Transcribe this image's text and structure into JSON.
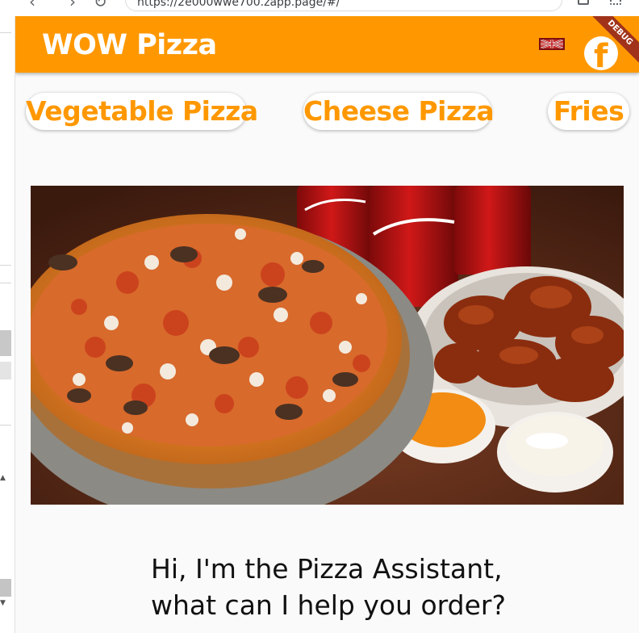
{
  "browser": {
    "url": "https://2e000wwe700.zapp.page/#/",
    "back_glyph": "‹",
    "forward_glyph": "›",
    "reload_glyph": "↻"
  },
  "appbar": {
    "title": "WOW Pizza",
    "debug_banner": "DEBUG",
    "facebook_glyph": "f",
    "accent_color": "#ff9800"
  },
  "categories": [
    {
      "label": "Vegetable Pizza"
    },
    {
      "label": "Cheese Pizza"
    },
    {
      "label": "Fries"
    }
  ],
  "hero": {
    "icon": "pizza-wings-coke-photo"
  },
  "assistant": {
    "line1": "Hi, I'm the Pizza Assistant,",
    "line2": "what can I help you order?"
  }
}
